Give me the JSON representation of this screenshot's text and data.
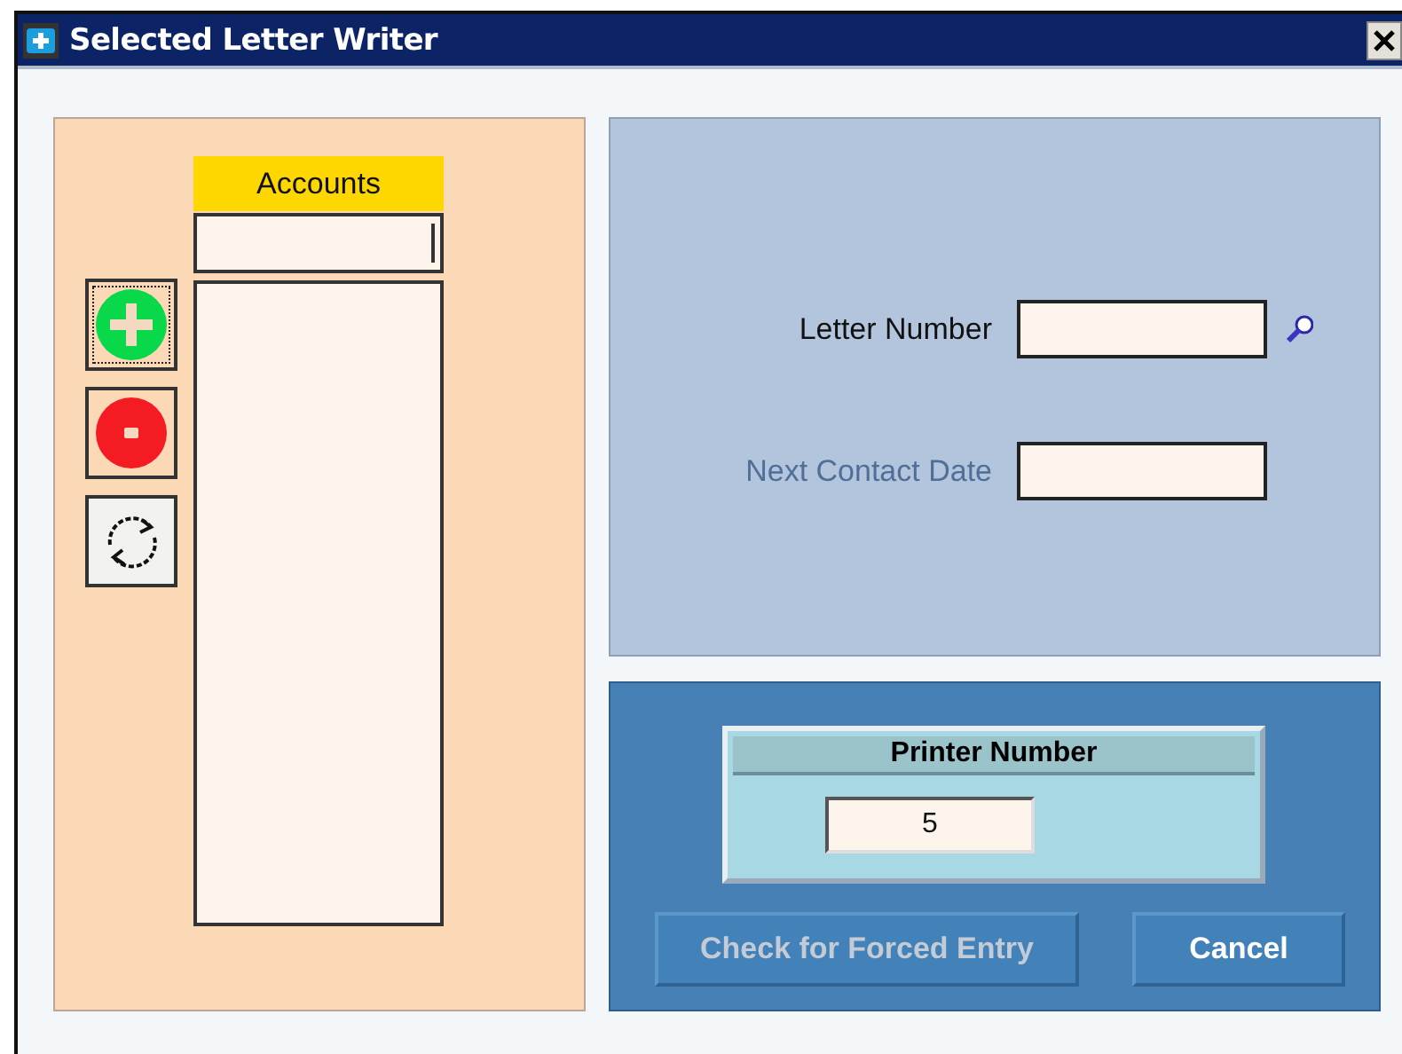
{
  "window": {
    "title": "Selected Letter Writer"
  },
  "accounts": {
    "header": "Accounts",
    "tools": [
      {
        "kind": "add",
        "focused": true
      },
      {
        "kind": "remove",
        "focused": false
      },
      {
        "kind": "refresh",
        "focused": false
      }
    ]
  },
  "letter_fields": [
    {
      "label": "Letter Number",
      "disabled": false,
      "lookup": true
    },
    {
      "label": "Next Contact Date",
      "disabled": true,
      "lookup": false
    }
  ],
  "printer": {
    "title": "Printer Number",
    "value": "5"
  },
  "buttons": [
    {
      "label": "Check for Forced Entry",
      "disabled": true
    },
    {
      "label": "Cancel",
      "disabled": false
    }
  ]
}
